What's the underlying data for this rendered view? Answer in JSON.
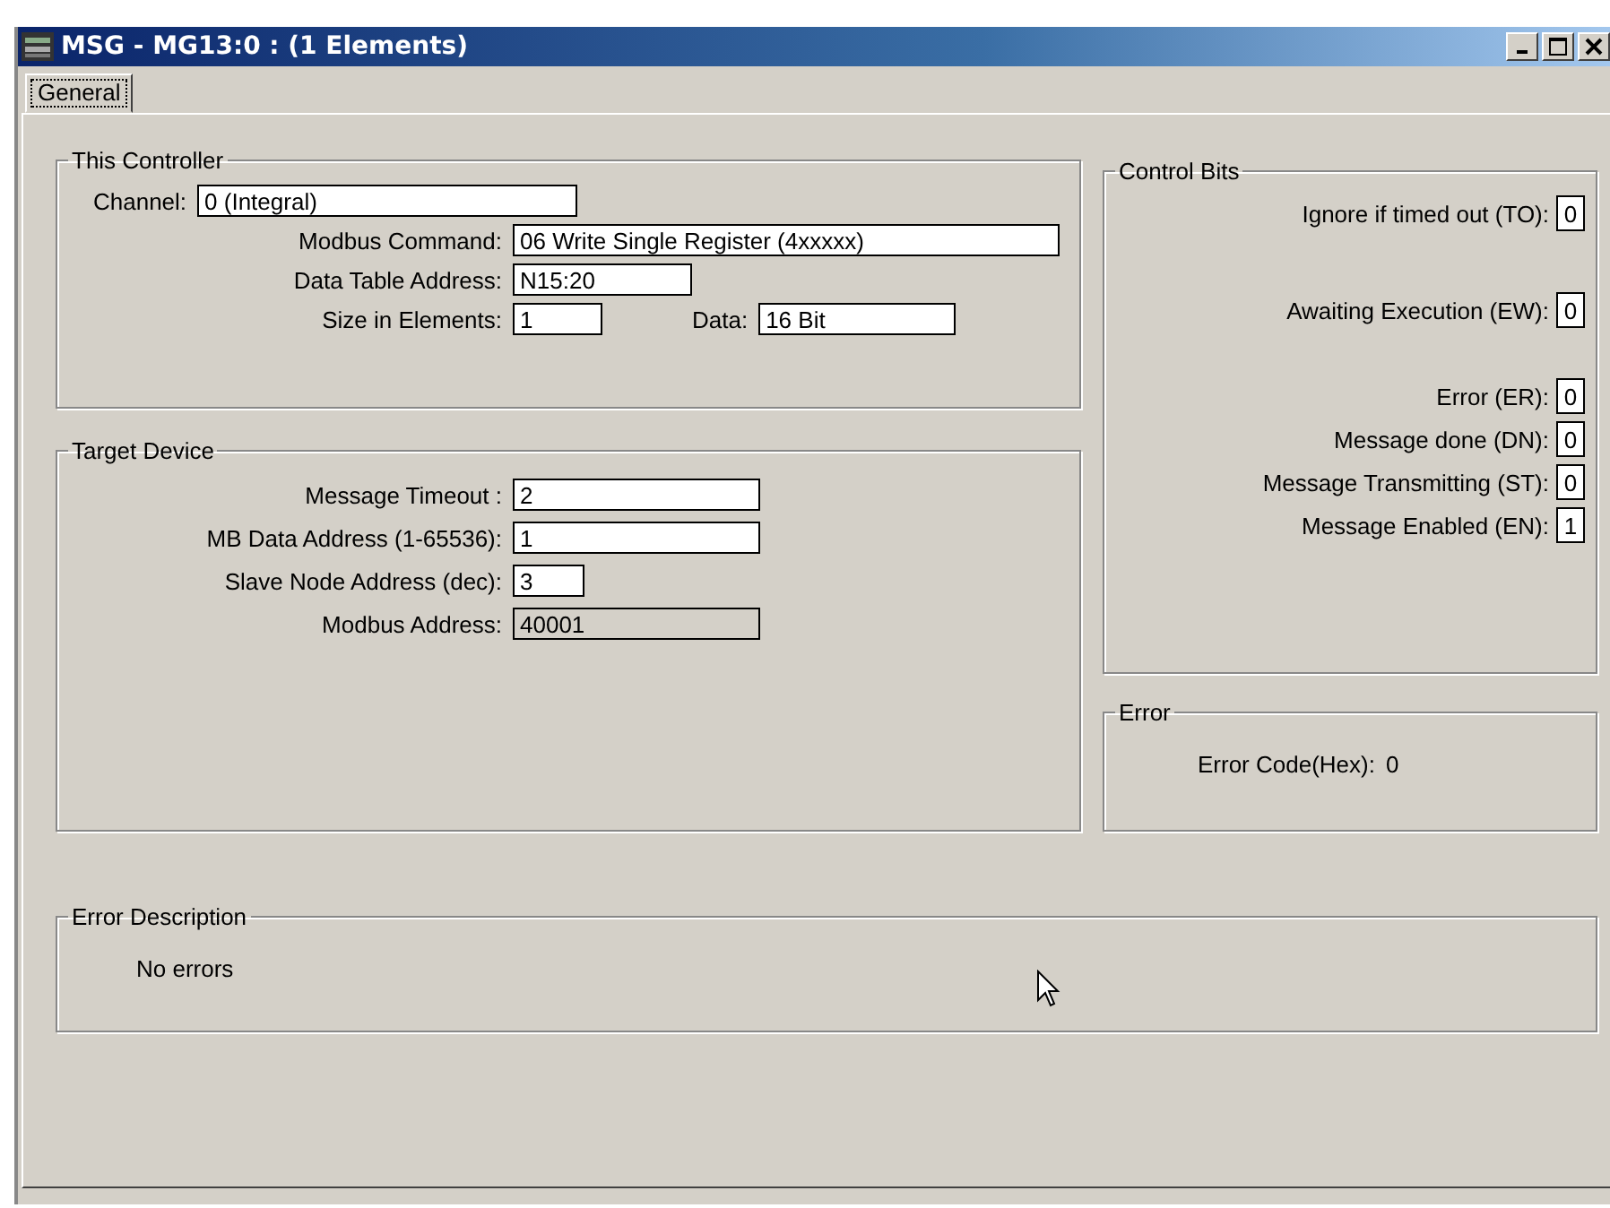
{
  "window": {
    "title": "MSG - MG13:0 : (1 Elements)"
  },
  "tabs": [
    {
      "label": "General",
      "selected": true
    }
  ],
  "this_controller": {
    "title": "This Controller",
    "rows": [
      {
        "label": "Channel:",
        "value": "0 (Integral)"
      },
      {
        "label": "Modbus Command:",
        "value": "06 Write Single Register (4xxxxx)"
      },
      {
        "label": "Data Table Address:",
        "value": "N15:20"
      },
      {
        "label": "Size in Elements:",
        "value": "1",
        "extra": {
          "label": "Data:",
          "value": "16 Bit"
        }
      }
    ]
  },
  "target_device": {
    "title": "Target Device",
    "rows": [
      {
        "label": "Message Timeout :",
        "value": "2",
        "disabled": false
      },
      {
        "label": "MB Data Address (1-65536):",
        "value": "1",
        "disabled": false
      },
      {
        "label": "Slave Node Address (dec):",
        "value": "3",
        "disabled": false
      },
      {
        "label": "Modbus Address:",
        "value": "40001",
        "disabled": true
      }
    ]
  },
  "control_bits": {
    "title": "Control Bits",
    "bits": [
      {
        "label": "Ignore if timed out (TO):",
        "value": "0"
      },
      {
        "label": "Awaiting Execution (EW):",
        "value": "0"
      },
      {
        "label": "Error (ER):",
        "value": "0"
      },
      {
        "label": "Message done (DN):",
        "value": "0"
      },
      {
        "label": "Message Transmitting (ST):",
        "value": "0"
      },
      {
        "label": "Message Enabled (EN):",
        "value": "1"
      }
    ]
  },
  "error": {
    "title": "Error",
    "label": "Error Code(Hex):",
    "value": "0"
  },
  "error_description": {
    "title": "Error Description",
    "text": "No errors"
  }
}
